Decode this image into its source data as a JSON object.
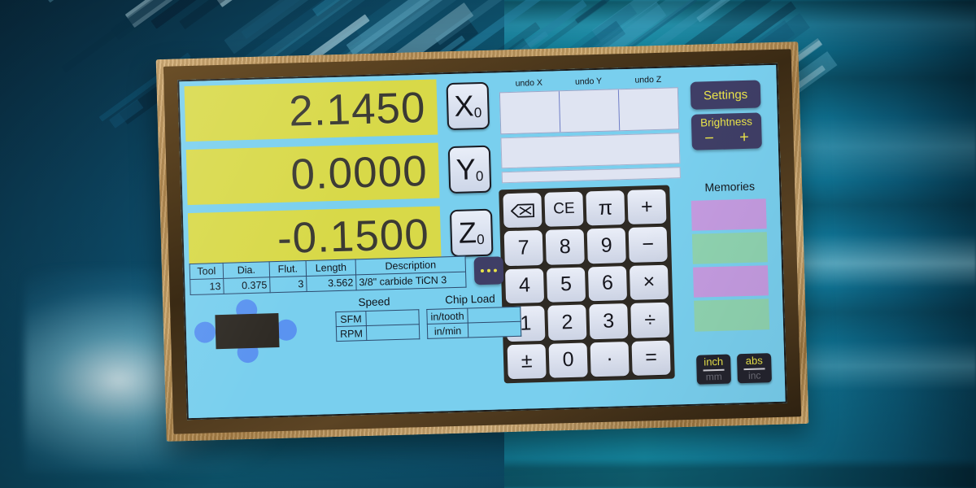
{
  "device": {
    "type": "digital-readout-touchscreen",
    "frame_color": "#b88e53",
    "screen_bg": "#79cfee"
  },
  "axes": [
    {
      "name": "X",
      "value": "2.1450",
      "button_letter": "X",
      "button_sub": "0",
      "field_color": "#d8d948"
    },
    {
      "name": "Y",
      "value": "0.0000",
      "button_letter": "Y",
      "button_sub": "0",
      "field_color": "#d8d948"
    },
    {
      "name": "Z",
      "value": "-0.1500",
      "button_letter": "Z",
      "button_sub": "0",
      "field_color": "#d8d948"
    }
  ],
  "undo": {
    "labels": [
      "undo X",
      "undo Y",
      "undo Z"
    ],
    "values": [
      "",
      "",
      ""
    ]
  },
  "calc_display": {
    "line1": "",
    "line2": ""
  },
  "keypad": {
    "keys": [
      {
        "label": "",
        "icon": "backspace-icon",
        "name": "backspace"
      },
      {
        "label": "CE",
        "icon": "",
        "name": "clear-entry"
      },
      {
        "label": "π",
        "icon": "",
        "name": "pi"
      },
      {
        "label": "+",
        "icon": "",
        "name": "plus"
      },
      {
        "label": "7",
        "icon": "",
        "name": "seven"
      },
      {
        "label": "8",
        "icon": "",
        "name": "eight"
      },
      {
        "label": "9",
        "icon": "",
        "name": "nine"
      },
      {
        "label": "−",
        "icon": "",
        "name": "minus"
      },
      {
        "label": "4",
        "icon": "",
        "name": "four"
      },
      {
        "label": "5",
        "icon": "",
        "name": "five"
      },
      {
        "label": "6",
        "icon": "",
        "name": "six"
      },
      {
        "label": "×",
        "icon": "",
        "name": "multiply"
      },
      {
        "label": "1",
        "icon": "",
        "name": "one"
      },
      {
        "label": "2",
        "icon": "",
        "name": "two"
      },
      {
        "label": "3",
        "icon": "",
        "name": "three"
      },
      {
        "label": "÷",
        "icon": "",
        "name": "divide"
      },
      {
        "label": "±",
        "icon": "",
        "name": "plus-minus"
      },
      {
        "label": "0",
        "icon": "",
        "name": "zero"
      },
      {
        "label": "·",
        "icon": "",
        "name": "decimal-point"
      },
      {
        "label": "=",
        "icon": "",
        "name": "equals"
      }
    ]
  },
  "right_panel": {
    "settings_label": "Settings",
    "brightness_label": "Brightness",
    "brightness_minus": "−",
    "brightness_plus": "+",
    "memories_label": "Memories",
    "memory_bands": [
      "#c49be0",
      "#8fd3b0",
      "#c49be0",
      "#8fd3b0"
    ],
    "accent_yellow": "#e9e34a",
    "navy": "#3f3e66"
  },
  "unit_buttons": [
    {
      "top": "inch",
      "bottom": "mm",
      "name": "inch-mm-toggle"
    },
    {
      "top": "abs",
      "bottom": "inc",
      "name": "abs-inc-toggle"
    }
  ],
  "tool_table": {
    "headers": [
      "Tool",
      "Dia.",
      "Flut.",
      "Length",
      "Description"
    ],
    "row": [
      "13",
      "0.375",
      "3",
      "3.562",
      "3/8\" carbide TiCN 3"
    ],
    "more_button": "..."
  },
  "speed": {
    "title": "Speed",
    "rows": [
      {
        "label": "SFM",
        "value": ""
      },
      {
        "label": "RPM",
        "value": ""
      }
    ]
  },
  "chip_load": {
    "title": "Chip Load",
    "rows": [
      {
        "label": "in/tooth",
        "value": ""
      },
      {
        "label": "in/min",
        "value": ""
      }
    ]
  },
  "tool_graphic": {
    "body_color": "#2e2a24",
    "handle_color": "#5a93f0",
    "handle_count": 4
  }
}
